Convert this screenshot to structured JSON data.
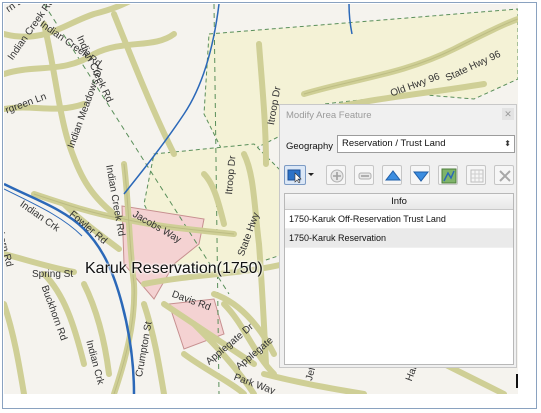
{
  "map": {
    "main_label": "Karuk Reservation(1750)",
    "street_labels": [
      "Indian Creek Rd",
      "Indian Creek Rd",
      "Indian Meadows Dr",
      "rgreen Ln",
      "Indian Creek Rd",
      "Jacobs Way",
      "Fowler Rd",
      "Indian Crk",
      "Itroop Dr",
      "State Hwy 96",
      "Old Hwy 96",
      "State Hwy",
      "Itroop Dr",
      "Spring St",
      "Buckhorn Rd",
      "Indian Creek Rd",
      "Davis Rd",
      "Crumpton St",
      "Applegate Dr",
      "Applegate",
      "Park Way",
      "Indian Crk",
      "hkorn Rd",
      "rn Dr",
      "Jef",
      "Ham"
    ]
  },
  "dialog": {
    "title": "Modify Area Feature",
    "close_icon": "close-icon",
    "geography_label": "Geography",
    "geography_value": "Reservation / Trust Land",
    "toolbar_icons": [
      "select-feature-icon",
      "dropdown-arrow-icon",
      "add-icon",
      "remove-icon",
      "move-up-icon",
      "move-down-icon",
      "map-view-icon",
      "grid-icon",
      "delete-icon"
    ],
    "table": {
      "header": "Info",
      "rows": [
        "1750-Karuk Off-Reservation Trust Land",
        "1750-Karuk Reservation"
      ]
    }
  },
  "colors": {
    "frame_border": "#8aa2c0",
    "map_background": "#f5f3ee",
    "road": "#cfcf96",
    "river": "#2b68b8",
    "reservation_fill": "#f4f2d6",
    "selected_fill": "#f4d2d2",
    "boundary": "#5a8f5a"
  }
}
